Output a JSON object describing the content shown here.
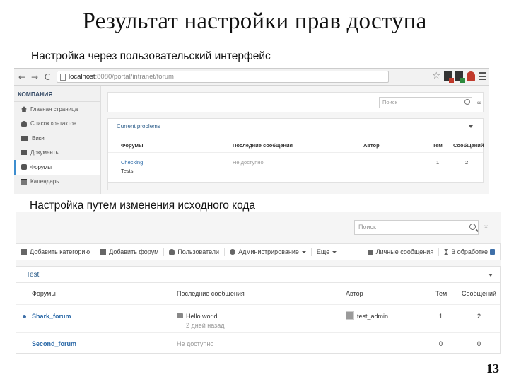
{
  "slide": {
    "title": "Результат настройки прав доступа",
    "caption1": "Настройка через пользовательский интерфейс",
    "caption2": "Настройка путем изменения исходного кода",
    "page_number": "13"
  },
  "screenshot1": {
    "browser": {
      "url_host": "localhost",
      "url_path": ":8080/portal/intranet/forum",
      "back_icon": "back-arrow-icon",
      "forward_icon": "forward-arrow-icon",
      "reload_icon": "reload-icon"
    },
    "sidebar": {
      "company": "КОМПАНИЯ",
      "items": [
        {
          "label": "Главная страница",
          "icon": "home-icon"
        },
        {
          "label": "Список контактов",
          "icon": "user-icon"
        },
        {
          "label": "Вики",
          "icon": "wiki-icon"
        },
        {
          "label": "Документы",
          "icon": "documents-icon"
        },
        {
          "label": "Форумы",
          "icon": "forum-icon"
        },
        {
          "label": "Календарь",
          "icon": "calendar-icon"
        }
      ]
    },
    "search_placeholder": "Поиск",
    "panel_title": "Current problems",
    "columns": {
      "forums": "Форумы",
      "last_messages": "Последние сообщения",
      "author": "Автор",
      "topics": "Тем",
      "messages": "Сообщений"
    },
    "rows": [
      {
        "forum": "Checking",
        "description": "Tests",
        "last_message": "Не доступно",
        "author": "",
        "topics": "1",
        "messages": "2"
      }
    ]
  },
  "screenshot2": {
    "search_placeholder": "Поиск",
    "toolbar": {
      "add_category": "Добавить категорию",
      "add_forum": "Добавить форум",
      "users": "Пользователи",
      "administration": "Администрирование",
      "more": "Еще",
      "private_messages": "Личные сообщения",
      "pending": "В обработке"
    },
    "panel_title": "Test",
    "columns": {
      "forums": "Форумы",
      "last_messages": "Последние сообщения",
      "author": "Автор",
      "topics": "Тем",
      "messages": "Сообщений"
    },
    "rows": [
      {
        "forum": "Shark_forum",
        "last_message": "Hello world",
        "last_time": "2 дней назад",
        "author": "test_admin",
        "topics": "1",
        "messages": "2"
      },
      {
        "forum": "Second_forum",
        "last_message": "Не доступно",
        "author": "",
        "topics": "0",
        "messages": "0"
      }
    ]
  }
}
